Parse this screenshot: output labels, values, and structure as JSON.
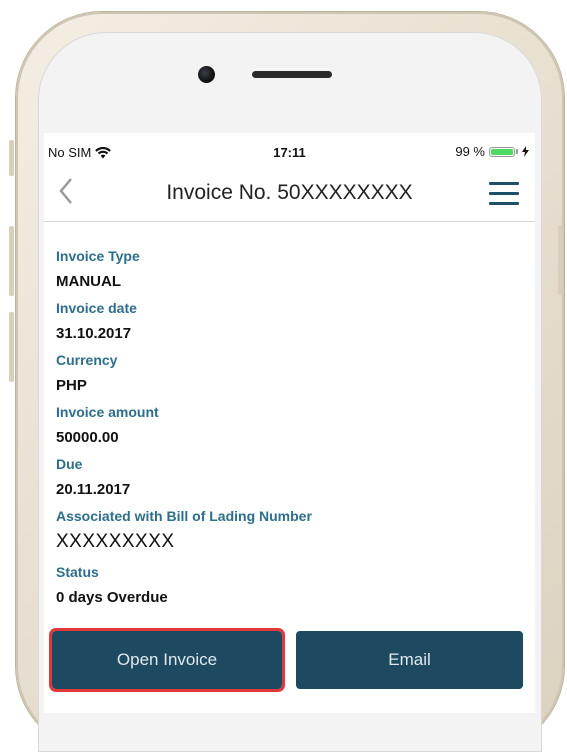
{
  "status_bar": {
    "carrier": "No SIM",
    "time": "17:11",
    "battery_percent": "99 %",
    "battery_level": 0.99
  },
  "navbar": {
    "back_icon": "chevron-left-icon",
    "title": "Invoice No. 50XXXXXXXX",
    "menu_icon": "hamburger-menu-icon"
  },
  "invoice": {
    "fields": [
      {
        "label": "Invoice Type",
        "value": "MANUAL"
      },
      {
        "label": "Invoice date",
        "value": "31.10.2017"
      },
      {
        "label": "Currency",
        "value": "PHP"
      },
      {
        "label": "Invoice amount",
        "value": "50000.00"
      },
      {
        "label": "Due",
        "value": "20.11.2017"
      },
      {
        "label": "Associated with Bill of Lading Number",
        "value": "XXXXXXXXX"
      },
      {
        "label": "Status",
        "value": "0 days Overdue"
      }
    ]
  },
  "actions": {
    "open_invoice_label": "Open Invoice",
    "email_label": "Email"
  },
  "colors": {
    "accent": "#1d4a60",
    "label": "#2d6e8a",
    "highlight": "#e0393c"
  }
}
